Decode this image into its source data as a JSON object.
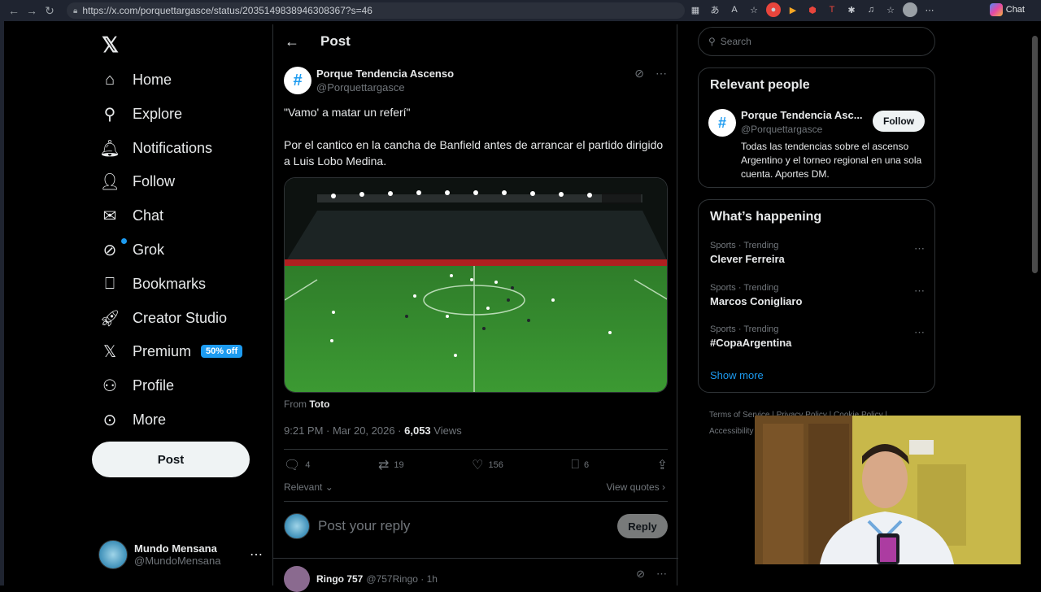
{
  "browser": {
    "url": "https://x.com/porquettargasce/status/2035149838946308367?s=46",
    "chat_label": "Chat"
  },
  "sidebar": {
    "items": [
      {
        "label": "Home",
        "icon": "home-icon"
      },
      {
        "label": "Explore",
        "icon": "search-icon"
      },
      {
        "label": "Notifications",
        "icon": "bell-icon"
      },
      {
        "label": "Follow",
        "icon": "add-person-icon"
      },
      {
        "label": "Chat",
        "icon": "mail-icon"
      },
      {
        "label": "Grok",
        "icon": "grok-icon"
      },
      {
        "label": "Bookmarks",
        "icon": "bookmark-icon"
      },
      {
        "label": "Creator Studio",
        "icon": "rocket-icon"
      },
      {
        "label": "Premium",
        "icon": "x-icon",
        "badge": "50% off"
      },
      {
        "label": "Profile",
        "icon": "person-icon"
      },
      {
        "label": "More",
        "icon": "more-circle-icon"
      }
    ],
    "post_button": "Post",
    "account": {
      "name": "Mundo Mensana",
      "handle": "@MundoMensana"
    }
  },
  "main": {
    "title": "Post",
    "author": {
      "name": "Porque Tendencia Ascenso",
      "handle": "@Porquettargasce"
    },
    "text_line1": "\"Vamo' a matar un referí\"",
    "text_line2": "Por el cantico en la cancha de Banfield antes de arrancar el partido dirigido a Luis Lobo Medina.",
    "from_label": "From",
    "from_source": "Toto",
    "time": "9:21 PM · Mar 20, 2026 · ",
    "views_count": "6,053",
    "views_label": " Views",
    "actions": {
      "replies": "4",
      "reposts": "19",
      "likes": "156",
      "bookmarks": "6"
    },
    "relevant_label": "Relevant",
    "view_quotes": "View quotes",
    "reply_placeholder": "Post your reply",
    "reply_button": "Reply",
    "next_reply": {
      "name": "Ringo 757",
      "handle": "@757Ringo · 1h"
    }
  },
  "right": {
    "search_placeholder": "Search",
    "relevant_people": {
      "title": "Relevant people",
      "name": "Porque Tendencia Asc...",
      "handle": "@Porquettargasce",
      "bio": "Todas las tendencias sobre el ascenso Argentino y el torneo regional en una sola cuenta. Aportes DM.",
      "follow": "Follow"
    },
    "happening": {
      "title": "What’s happening",
      "trends": [
        {
          "category": "Sports · Trending",
          "topic": "Clever Ferreira"
        },
        {
          "category": "Sports · Trending",
          "topic": "Marcos Conigliaro"
        },
        {
          "category": "Sports · Trending",
          "topic": "#CopaArgentina"
        }
      ],
      "show_more": "Show more"
    },
    "footer": {
      "terms": "Terms of Service",
      "privacy": "Privacy Policy",
      "cookie": "Cookie Policy",
      "accessibility": "Accessibility"
    }
  }
}
